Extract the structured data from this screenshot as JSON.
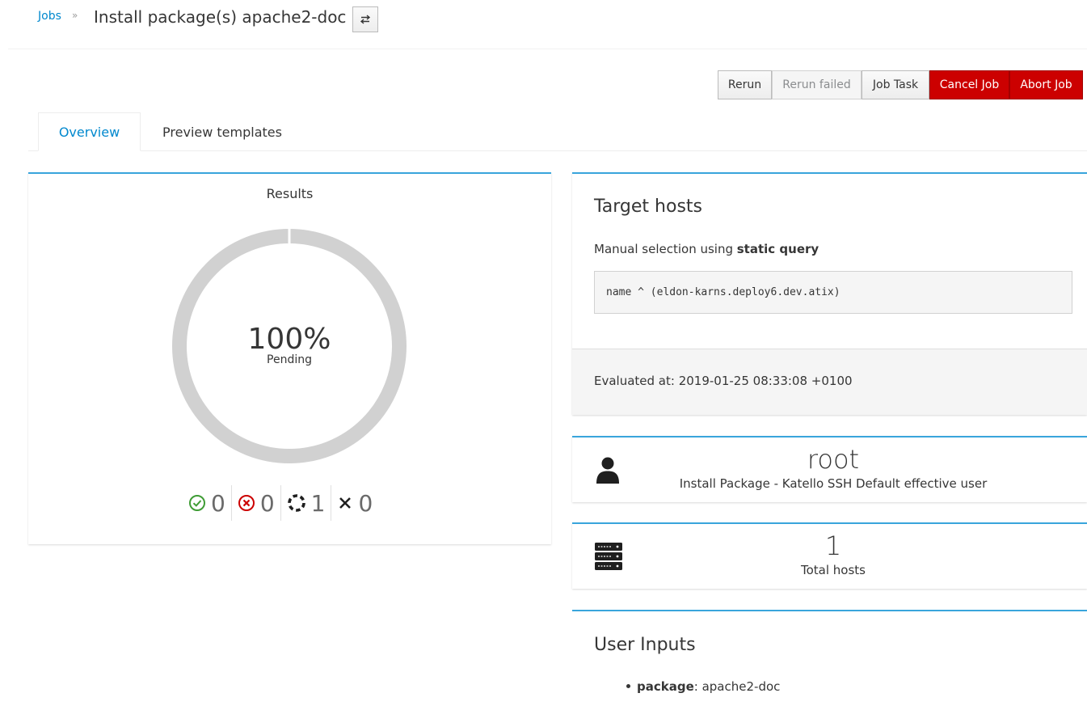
{
  "breadcrumb": {
    "parent": "Jobs",
    "separator": "»",
    "title": "Install package(s) apache2-doc",
    "switcher_icon": "switch-icon"
  },
  "actions": {
    "rerun": "Rerun",
    "rerun_failed": "Rerun failed",
    "job_task": "Job Task",
    "cancel_job": "Cancel Job",
    "abort_job": "Abort Job"
  },
  "tabs": [
    {
      "label": "Overview",
      "active": true
    },
    {
      "label": "Preview templates",
      "active": false
    }
  ],
  "results": {
    "title": "Results",
    "percent": "100%",
    "status": "Pending",
    "progress_fraction": 1.0,
    "stats": [
      {
        "icon": "success-icon",
        "value": "0",
        "color": "#3f9c35"
      },
      {
        "icon": "error-icon",
        "value": "0",
        "color": "#cc0000"
      },
      {
        "icon": "pending-icon",
        "value": "1",
        "color": "#363636"
      },
      {
        "icon": "cancelled-icon",
        "value": "0",
        "color": "#363636"
      }
    ]
  },
  "target_hosts": {
    "title": "Target hosts",
    "description_prefix": "Manual selection using ",
    "description_bold": "static query",
    "query": "name ^ (eldon-karns.deploy6.dev.atix)",
    "evaluated": "Evaluated at: 2019-01-25 08:33:08 +0100"
  },
  "effective_user": {
    "icon": "user-icon",
    "name": "root",
    "description": "Install Package - Katello SSH Default effective user"
  },
  "hosts": {
    "icon": "server-icon",
    "count": "1",
    "label": "Total hosts"
  },
  "user_inputs": {
    "title": "User Inputs",
    "items": [
      {
        "key": "package",
        "separator": ": ",
        "value": "apache2-doc"
      }
    ]
  },
  "colors": {
    "accent": "#39a5dc",
    "link": "#0088ce",
    "danger": "#cc0000",
    "donut_track": "#d1d1d1"
  }
}
